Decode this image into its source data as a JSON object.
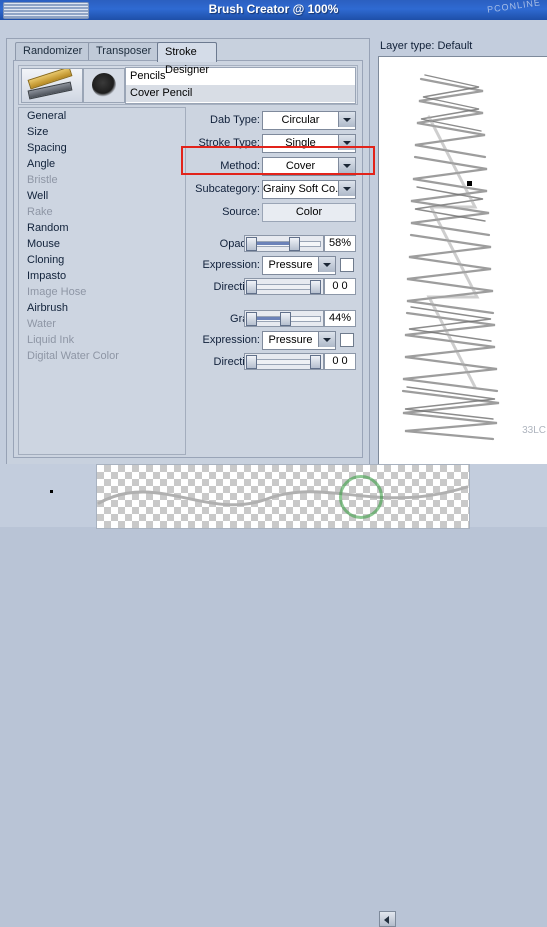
{
  "window": {
    "title": "Brush Creator @ 100%",
    "watermark_top": "PCONLINE",
    "watermark_canvas": "33LC"
  },
  "tabs": [
    {
      "label": "Randomizer",
      "selected": false
    },
    {
      "label": "Transposer",
      "selected": false
    },
    {
      "label": "Stroke Designer",
      "selected": true
    }
  ],
  "brush": {
    "category": "Pencils",
    "variant": "Cover Pencil"
  },
  "categories": [
    {
      "label": "General",
      "enabled": true
    },
    {
      "label": "Size",
      "enabled": true
    },
    {
      "label": "Spacing",
      "enabled": true
    },
    {
      "label": "Angle",
      "enabled": true
    },
    {
      "label": "Bristle",
      "enabled": false
    },
    {
      "label": "Well",
      "enabled": true
    },
    {
      "label": "Rake",
      "enabled": false
    },
    {
      "label": "Random",
      "enabled": true
    },
    {
      "label": "Mouse",
      "enabled": true
    },
    {
      "label": "Cloning",
      "enabled": true
    },
    {
      "label": "Impasto",
      "enabled": true
    },
    {
      "label": "Image Hose",
      "enabled": false
    },
    {
      "label": "Airbrush",
      "enabled": true
    },
    {
      "label": "Water",
      "enabled": false
    },
    {
      "label": "Liquid Ink",
      "enabled": false
    },
    {
      "label": "Digital Water Color",
      "enabled": false
    }
  ],
  "general": {
    "dab_type": {
      "label": "Dab Type:",
      "value": "Circular"
    },
    "stroke_type": {
      "label": "Stroke Type:",
      "value": "Single"
    },
    "method": {
      "label": "Method:",
      "value": "Cover"
    },
    "subcategory": {
      "label": "Subcategory:",
      "value": "Grainy Soft Co..."
    },
    "source": {
      "label": "Source:",
      "value": "Color"
    },
    "opacity": {
      "label": "Opacity:",
      "value": "58%",
      "percent": 58
    },
    "opacity_expression": {
      "label": "Expression:",
      "value": "Pressure",
      "invert": false
    },
    "opacity_direction": {
      "label": "Direction:",
      "value": "0 0",
      "percent": 0
    },
    "grain": {
      "label": "Grain:",
      "value": "44%",
      "percent": 44
    },
    "grain_expression": {
      "label": "Expression:",
      "value": "Pressure",
      "invert": false
    },
    "grain_direction": {
      "label": "Direction:",
      "value": "0 0",
      "percent": 0
    }
  },
  "canvas": {
    "layer_label": "Layer type: Default"
  },
  "colors": {
    "highlight": "#e2231a",
    "titlebar": "#2f6ad2",
    "slider_fill": "#6b82b8"
  }
}
